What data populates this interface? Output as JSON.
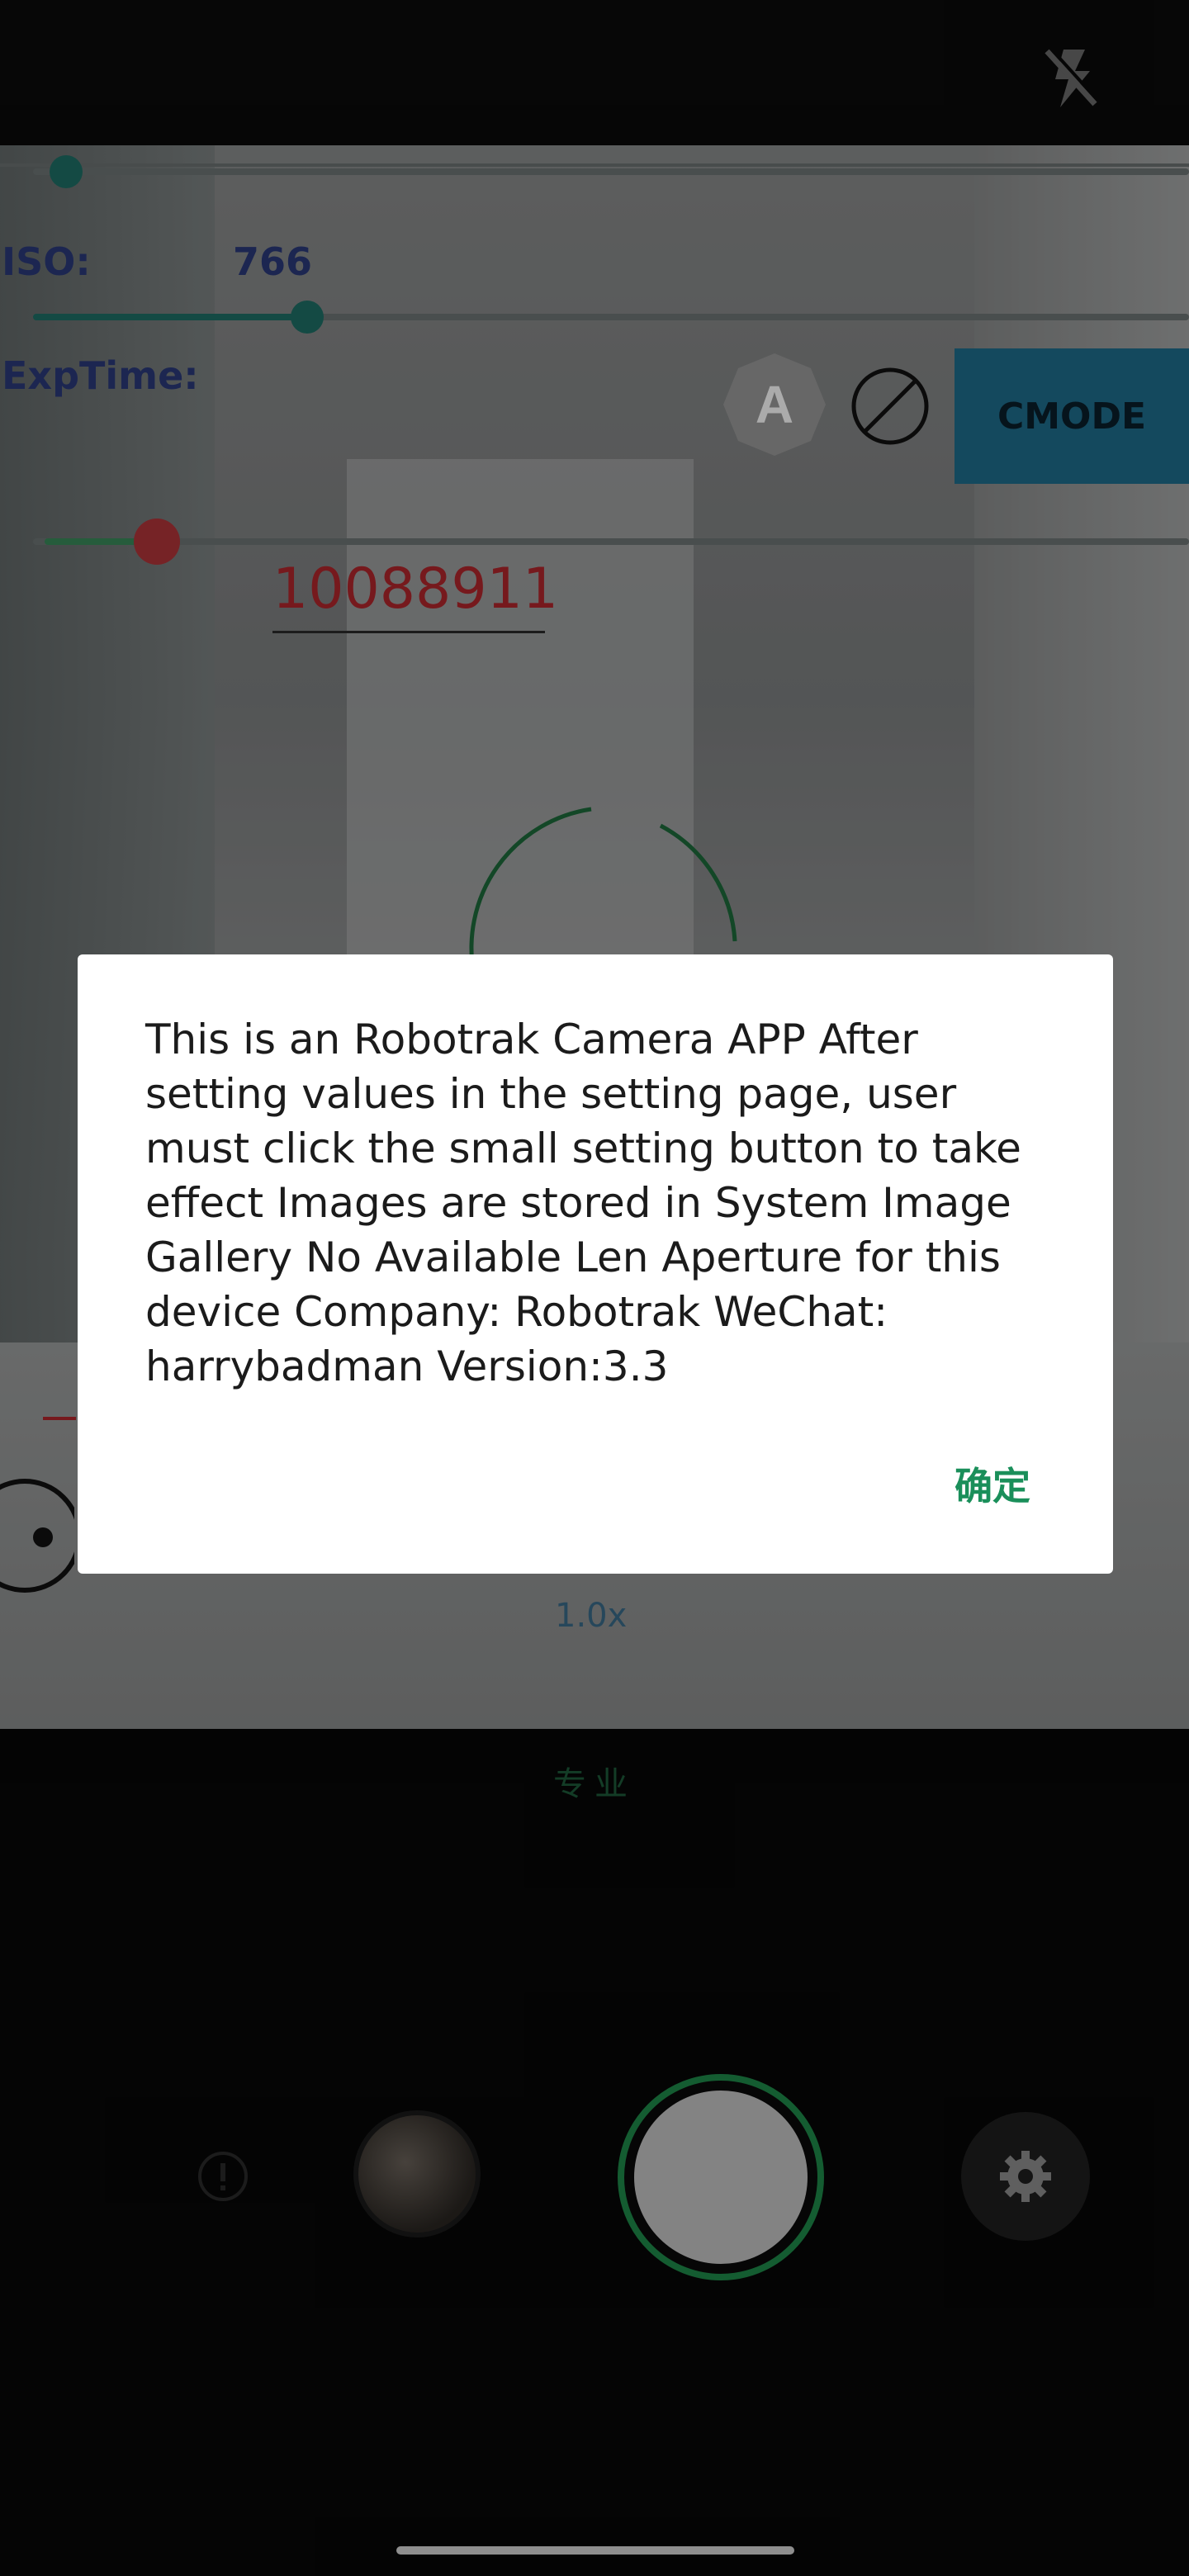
{
  "status_bar": {
    "flash_icon": "flash-off-icon"
  },
  "overlay": {
    "iso_label": "ISO:",
    "iso_value": "766",
    "exptime_label": "ExpTime:",
    "exptime_value": "10088911",
    "iso_slider_level": 0.26,
    "cmode_label": "CMODE",
    "mode_auto_label": "A",
    "zoom_value": "1.0x"
  },
  "dialog": {
    "message": "This is an Robotrak Camera APP After setting values in the setting page, user must click the small setting button to take effect Images are stored in System Image Gallery No Available Len Aperture for this device Company: Robotrak WeChat: harrybadman Version:3.3",
    "ok_label": "确定"
  },
  "bottom": {
    "mode_label": "专业",
    "info_icon": "info-icon",
    "gallery_icon": "gallery-thumbnail",
    "shutter_icon": "shutter-button",
    "settings_icon": "gear-icon"
  },
  "colors": {
    "accent_green": "#1a8f5a",
    "shutter_ring": "#1f8a4a",
    "cmode_bg": "#1f6d8c",
    "exp_value_red": "#b0262c"
  }
}
